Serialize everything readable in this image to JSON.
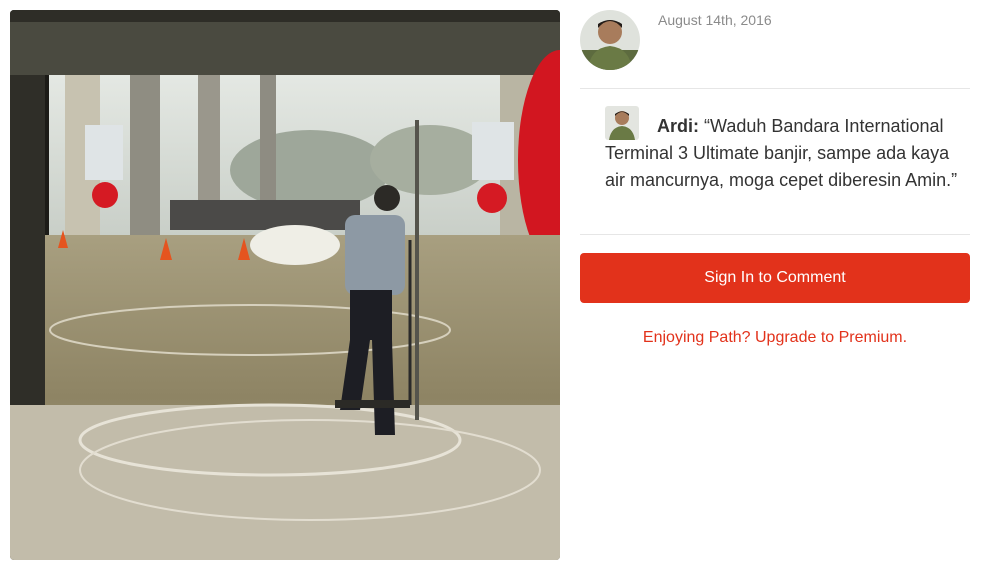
{
  "post": {
    "date": "August 14th, 2016"
  },
  "comment": {
    "author": "Ardi:",
    "text": "“Waduh Bandara International Terminal 3 Ultimate banjir, sampe ada kaya air mancurnya, moga cepet diberesin Amin.”"
  },
  "actions": {
    "sign_in_label": "Sign In to Comment",
    "upgrade_label": "Enjoying Path? Upgrade to Premium."
  },
  "colors": {
    "accent": "#e2321b",
    "date_text": "#8b8b8b",
    "divider": "#e6e6e6"
  }
}
